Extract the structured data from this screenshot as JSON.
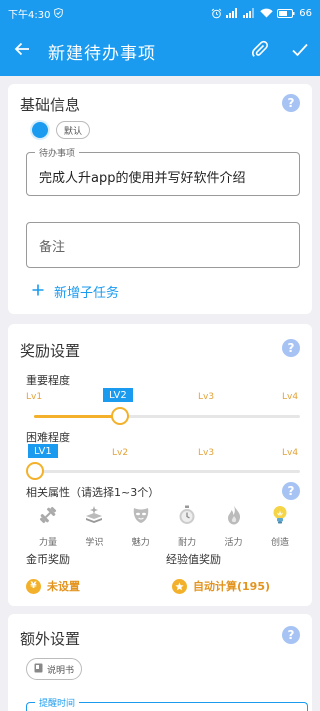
{
  "status_bar": {
    "time": "下午4:30",
    "battery": "66"
  },
  "app_bar": {
    "title": "新建待办事项"
  },
  "basic": {
    "title": "基础信息",
    "tag_label": "默认",
    "todo_label": "待办事项",
    "todo_value": "完成人升app的使用并写好软件介绍",
    "note_placeholder": "备注",
    "add_subtask": "新增子任务"
  },
  "reward": {
    "title": "奖励设置",
    "importance_label": "重要程度",
    "importance_levels": [
      "Lv1",
      "Lv2",
      "Lv3",
      "Lv4"
    ],
    "importance_selected": "LV2",
    "importance_value": 2,
    "difficulty_label": "困难程度",
    "difficulty_levels": [
      "Lv1",
      "Lv2",
      "Lv3",
      "Lv4"
    ],
    "difficulty_selected": "LV1",
    "difficulty_value": 1,
    "attributes_label": "相关属性（请选择1~3个）",
    "attributes": [
      {
        "label": "力量",
        "icon": "dumbbell-icon"
      },
      {
        "label": "学识",
        "icon": "book-icon"
      },
      {
        "label": "魅力",
        "icon": "mask-icon"
      },
      {
        "label": "耐力",
        "icon": "stopwatch-icon"
      },
      {
        "label": "活力",
        "icon": "flame-icon"
      },
      {
        "label": "创造",
        "icon": "lightbulb-icon"
      }
    ],
    "gold_label": "金币奖励",
    "gold_value": "未设置",
    "gold_icon_text": "¥",
    "exp_label": "经验值奖励",
    "exp_value": "自动计算(195)"
  },
  "extra": {
    "title": "额外设置",
    "manual_chip": "说明书",
    "reminder_label": "提醒时间"
  },
  "colors": {
    "primary": "#1a9bf0",
    "accent": "#f3b12b",
    "help": "#a6c3f4",
    "background": "#efeff4"
  }
}
